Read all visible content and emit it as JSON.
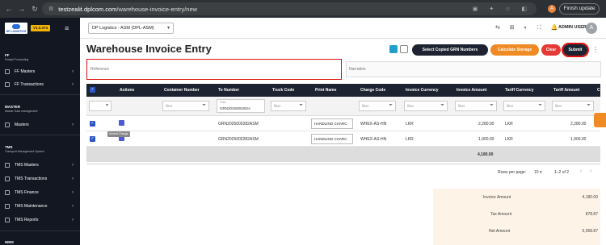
{
  "browser": {
    "url_host": "testzealit.dplcom.com",
    "url_path": "/warehouse-invoice-entry/new",
    "profile_initial": "A",
    "finish_update": "Finish update"
  },
  "sidebar": {
    "logo_text": "DP LOGISTICS",
    "version": "V1.0.374",
    "sections": [
      {
        "title": "FF",
        "subtitle": "Freight Forwarding"
      },
      {
        "title": "MASTER",
        "subtitle": "Master Data management"
      },
      {
        "title": "TMS",
        "subtitle": "Transport Management System"
      },
      {
        "title": "WMS",
        "subtitle": ""
      }
    ],
    "items": [
      {
        "label": "FF Masters"
      },
      {
        "label": "FF Transactions"
      },
      {
        "label": "Masters"
      },
      {
        "label": "TMS Masters"
      },
      {
        "label": "TMS Transactions"
      },
      {
        "label": "TMS Finance"
      },
      {
        "label": "TMS Maintenance"
      },
      {
        "label": "TMS Reports"
      }
    ]
  },
  "topbar": {
    "company": "DP Logistics - ASM  (DPL-ASM)",
    "user": "ADMIN USER",
    "avatar": "A"
  },
  "page": {
    "title": "Warehouse Invoice Entry",
    "buttons": {
      "select_copied": "Select Copied GRN Numbers",
      "calculate": "Calculate Storage",
      "clear": "Clear",
      "submit": "Submit"
    },
    "reference_label": "Reference",
    "narration_label": "Narration"
  },
  "table": {
    "columns": [
      "Actions",
      "Container Number",
      "To Number",
      "Truck Code",
      "Print Name",
      "Charge Code",
      "Invoice Currency",
      "Invoice Amount",
      "Tariff Currency",
      "Tariff Amount",
      "C"
    ],
    "filter_placeholder": "filter",
    "to_filter_label": "Filter",
    "to_filter_value": "GRN2025000282A",
    "tooltip": "Amend Charge",
    "rows": [
      {
        "to_number": "GRN2025000282ASM",
        "print_name": "HANDLING CHARC",
        "charge_code": "WHEX-AS-HN",
        "invoice_currency": "LKR",
        "invoice_amount": "2,280.00",
        "tariff_currency": "LKR",
        "tariff_amount": "2,280.00"
      },
      {
        "to_number": "GRN2025000282ASM",
        "print_name": "HANDLING CHARC",
        "charge_code": "WHEX-AS-HN",
        "invoice_currency": "LKR",
        "invoice_amount": "1,900.00",
        "tariff_currency": "LKR",
        "tariff_amount": "1,900.00"
      }
    ],
    "total": "4,180.00",
    "rows_per_page_label": "Rows per page:",
    "rows_per_page": "10",
    "range": "1–2 of 2"
  },
  "summary": {
    "invoice_amount_label": "Invoice Amount",
    "invoice_amount": "4,180.00",
    "tax_amount_label": "Tax Amount",
    "tax_amount": "878.87",
    "net_amount_label": "Net Amount",
    "net_amount": "5,058.87"
  }
}
